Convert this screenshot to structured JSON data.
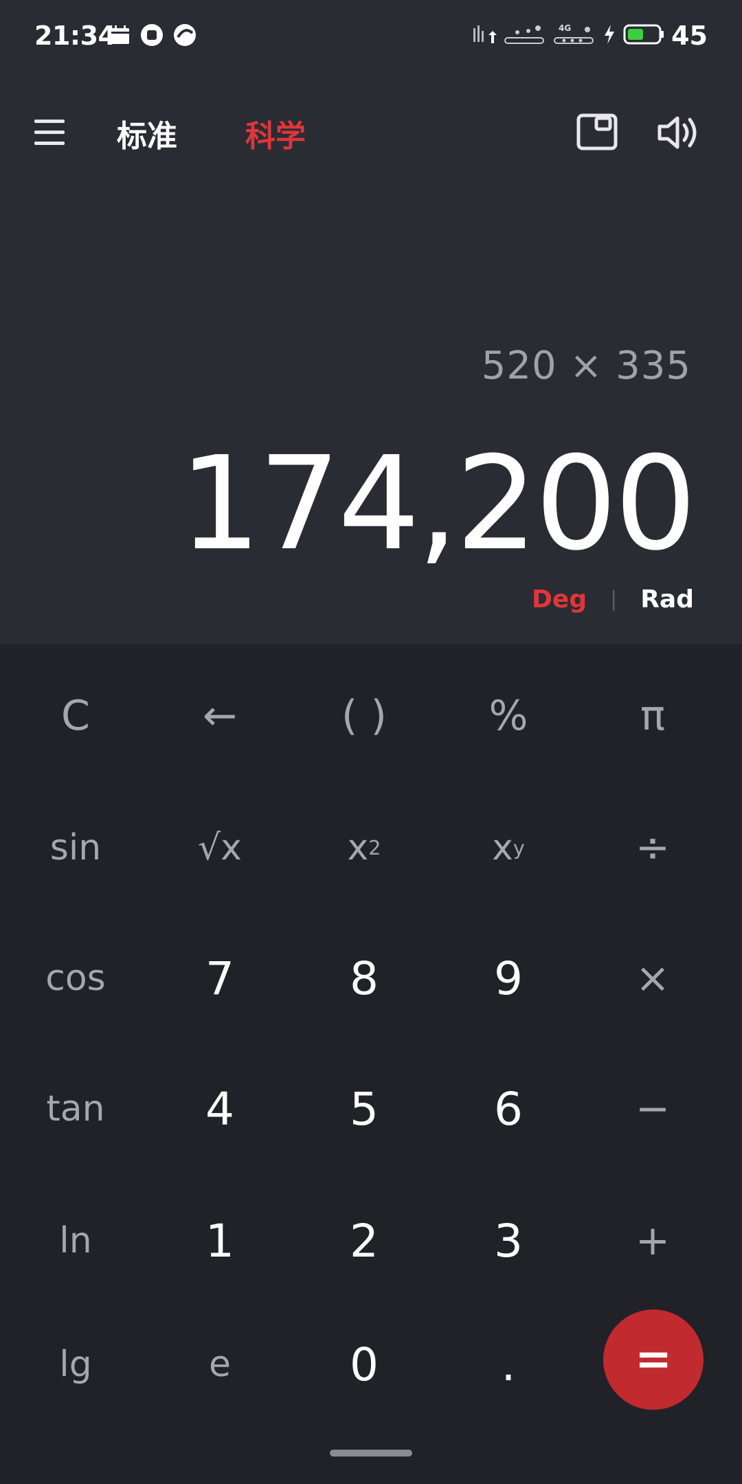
{
  "status_bar": {
    "time": "21:34",
    "battery_level": "45",
    "network": "4G",
    "icons": [
      "calendar-icon",
      "app-icon",
      "browser-icon",
      "signal-icon",
      "wifi-icon",
      "charging-icon",
      "battery-icon"
    ]
  },
  "header": {
    "menu_icon": "hamburger-menu-icon",
    "tabs": [
      {
        "label": "标准",
        "active": false
      },
      {
        "label": "科学",
        "active": true
      }
    ],
    "accent_color": "#e0363a"
  },
  "display": {
    "expression": "520 × 335",
    "result": "174,200",
    "angle_modes": {
      "deg": "Deg",
      "rad": "Rad",
      "active": "Deg"
    }
  },
  "keys": {
    "row1": [
      "C",
      "←",
      "( )",
      "%",
      "π"
    ],
    "row2": {
      "sin": "sin",
      "sqrt": "√x",
      "square_base": "x",
      "square_exp": "2",
      "pow_base": "x",
      "pow_exp": "y",
      "divide": "÷"
    },
    "row3": [
      "cos",
      "7",
      "8",
      "9",
      "×"
    ],
    "row4": [
      "tan",
      "4",
      "5",
      "6",
      "−"
    ],
    "row5": [
      "ln",
      "1",
      "2",
      "3",
      "+"
    ],
    "row6": [
      "lg",
      "e",
      "0",
      ".",
      "="
    ]
  },
  "colors": {
    "background": "#202228",
    "display_background": "#2a2c33",
    "equals_button": "#c12a2e",
    "secondary_text": "#a5a7ad"
  }
}
